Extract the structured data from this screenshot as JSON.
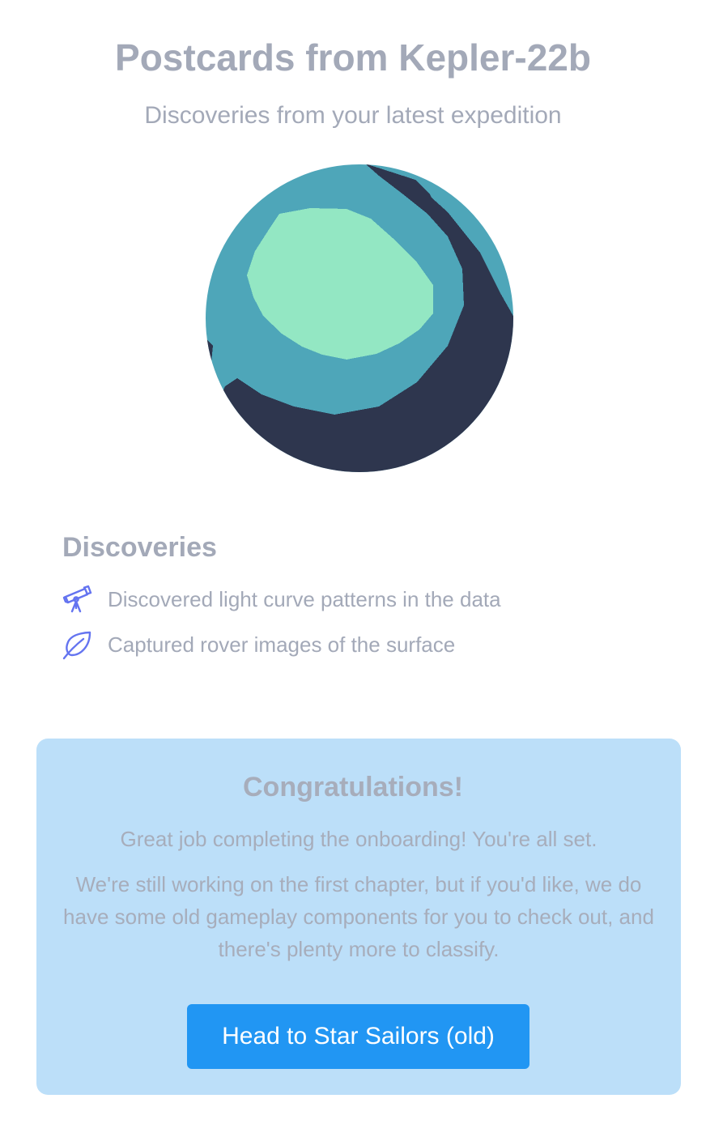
{
  "header": {
    "title": "Postcards from Kepler-22b",
    "subtitle": "Discoveries from your latest expedition"
  },
  "planet": {
    "colors": {
      "ocean": "#4ea6b9",
      "land": "#93e7c3",
      "shadow": "#2e364e"
    }
  },
  "discoveries": {
    "heading": "Discoveries",
    "items": [
      {
        "icon": "telescope-icon",
        "text": "Discovered light curve patterns in the data"
      },
      {
        "icon": "leaf-icon",
        "text": "Captured rover images of the surface"
      }
    ],
    "icon_color": "#6474f0"
  },
  "congrats": {
    "title": "Congratulations!",
    "line1": "Great job completing the onboarding! You're all set.",
    "line2": "We're still working on the first chapter, but if you'd like, we do have some old gameplay components for you to check out, and there's plenty more to classify.",
    "button_label": "Head to Star Sailors (old)",
    "background": "#bcdff9",
    "button_color": "#2196f3"
  }
}
